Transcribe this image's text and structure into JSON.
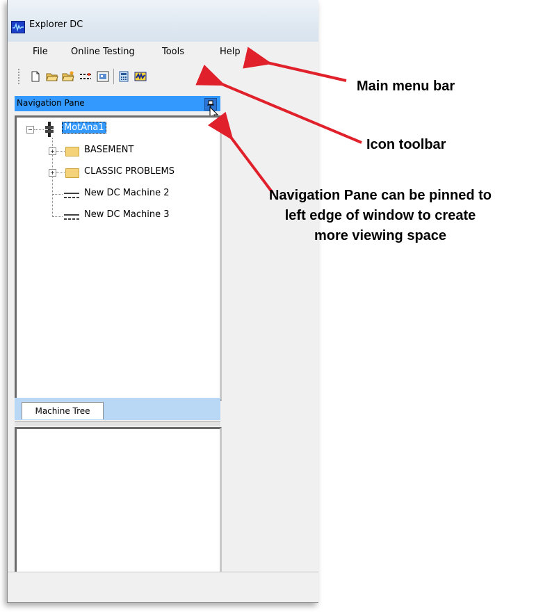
{
  "window": {
    "title": "Explorer DC"
  },
  "menu": {
    "items": [
      "File",
      "Online Testing",
      "Tools",
      "Help"
    ]
  },
  "toolbar": {
    "icons": [
      "new-file-icon",
      "open-folder-icon",
      "open-recent-icon",
      "settings-icon",
      "report-icon",
      "calculator-icon",
      "analyzer-icon"
    ]
  },
  "nav_pane": {
    "title": "Navigation Pane",
    "tab_label": "Machine Tree",
    "tree": {
      "root": "MotAna1",
      "children": [
        "BASEMENT",
        "CLASSIC PROBLEMS",
        "New DC Machine 2",
        "New DC Machine 3"
      ]
    }
  },
  "annotations": {
    "menu_bar": "Main menu bar",
    "icon_toolbar": "Icon toolbar",
    "callout_line1": "Navigation Pane can be pinned to",
    "callout_line2": "left edge of window to create",
    "callout_line3": "more viewing space"
  },
  "colors": {
    "selection": "#3399ff",
    "arrow": "#e0202a",
    "tab_strip": "#b9d8f5"
  }
}
